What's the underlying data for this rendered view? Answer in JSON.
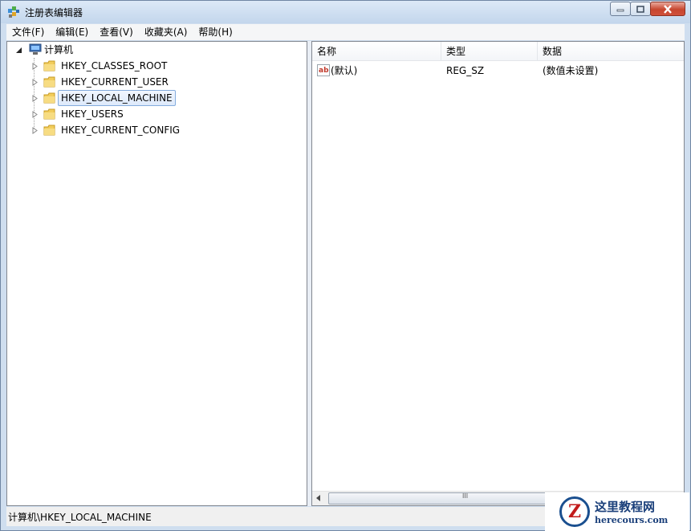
{
  "window": {
    "title": "注册表编辑器",
    "title_icon": "regedit-icon"
  },
  "menu": [
    "文件(F)",
    "编辑(E)",
    "查看(V)",
    "收藏夹(A)",
    "帮助(H)"
  ],
  "tree": {
    "root": "计算机",
    "children": [
      {
        "label": "HKEY_CLASSES_ROOT",
        "selected": false
      },
      {
        "label": "HKEY_CURRENT_USER",
        "selected": false
      },
      {
        "label": "HKEY_LOCAL_MACHINE",
        "selected": true
      },
      {
        "label": "HKEY_USERS",
        "selected": false
      },
      {
        "label": "HKEY_CURRENT_CONFIG",
        "selected": false
      }
    ]
  },
  "list": {
    "columns": [
      "名称",
      "类型",
      "数据"
    ],
    "rows": [
      {
        "icon": "string-value-icon",
        "name": "(默认)",
        "type": "REG_SZ",
        "data": "(数值未设置)"
      }
    ]
  },
  "statusbar": {
    "path": "计算机\\HKEY_LOCAL_MACHINE"
  },
  "scroll_glyph": "III",
  "watermark": {
    "letter": "Z",
    "cn": "这里教程网",
    "en": "herecours.com"
  },
  "colors": {
    "selection_border": "#84acdd",
    "titlebar": "#c3d6ec",
    "close_button": "#c7462f"
  }
}
